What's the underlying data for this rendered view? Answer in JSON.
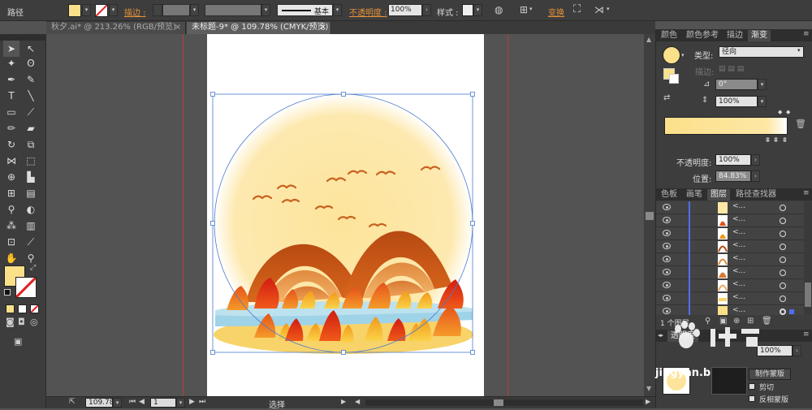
{
  "control_bar": {
    "object_type": "路径",
    "stroke_label": "描边 :",
    "stroke_style": "基本",
    "opacity_label": "不透明度 :",
    "opacity_value": "100%",
    "style_label": "样式 :",
    "transform_link": "变换"
  },
  "doc_tabs": [
    {
      "label": "秋夕.ai* @ 213.26% (RGB/预览)",
      "close": "×"
    },
    {
      "label": "未标题-9* @ 109.78% (CMYK/预览)",
      "close": "×"
    }
  ],
  "status": {
    "zoom": "109.78",
    "page": "1",
    "tool_name": "选择"
  },
  "gradient_panel": {
    "tabs": [
      "颜色",
      "颜色参考",
      "描边",
      "渐变"
    ],
    "type_label": "类型:",
    "type_value": "径向",
    "stroke_label": "描边:",
    "angle_value": "0°",
    "ratio_value": "100%",
    "opacity_label": "不透明度:",
    "opacity_value": "100%",
    "position_label": "位置:",
    "position_value": "84.83%"
  },
  "layers_panel": {
    "tabs": [
      "色板",
      "画笔",
      "图层",
      "路径查找器"
    ],
    "layer_name": "<...",
    "layer_count": "1 个图层"
  },
  "transparency_panel": {
    "tab": "透明度",
    "opacity_value": "100%",
    "make_mask_button": "制作蒙版",
    "clip_label": "剪切",
    "invert_label": "反相蒙版"
  },
  "watermark": {
    "text": "jingyan.b"
  },
  "colors": {
    "fill": "#fbe08a",
    "sun": "#fde7a4",
    "orange": "#e8923a",
    "layer_bar": "#4f6ff0"
  }
}
